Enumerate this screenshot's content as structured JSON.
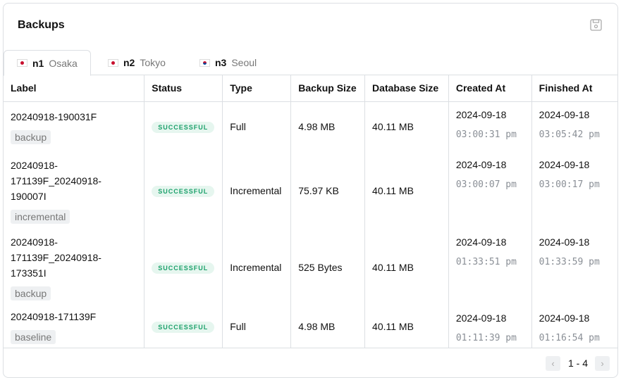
{
  "title": "Backups",
  "tabs": [
    {
      "node": "n1",
      "city": "Osaka",
      "flag": "jp"
    },
    {
      "node": "n2",
      "city": "Tokyo",
      "flag": "jp"
    },
    {
      "node": "n3",
      "city": "Seoul",
      "flag": "kr"
    }
  ],
  "columns": [
    "Label",
    "Status",
    "Type",
    "Backup Size",
    "Database Size",
    "Created At",
    "Finished At"
  ],
  "rows": [
    {
      "label": "20240918-190031F",
      "tag": "backup",
      "status": "SUCCESSFUL",
      "type": "Full",
      "backup_size": "4.98 MB",
      "db_size": "40.11 MB",
      "created_date": "2024-09-18",
      "created_time": "03:00:31 pm",
      "finished_date": "2024-09-18",
      "finished_time": "03:05:42 pm"
    },
    {
      "label": "20240918-171139F_20240918-190007I",
      "tag": "incremental",
      "status": "SUCCESSFUL",
      "type": "Incremental",
      "backup_size": "75.97 KB",
      "db_size": "40.11 MB",
      "created_date": "2024-09-18",
      "created_time": "03:00:07 pm",
      "finished_date": "2024-09-18",
      "finished_time": "03:00:17 pm"
    },
    {
      "label": "20240918-171139F_20240918-173351I",
      "tag": "backup",
      "status": "SUCCESSFUL",
      "type": "Incremental",
      "backup_size": "525 Bytes",
      "db_size": "40.11 MB",
      "created_date": "2024-09-18",
      "created_time": "01:33:51 pm",
      "finished_date": "2024-09-18",
      "finished_time": "01:33:59 pm"
    },
    {
      "label": "20240918-171139F",
      "tag": "baseline",
      "status": "SUCCESSFUL",
      "type": "Full",
      "backup_size": "4.98 MB",
      "db_size": "40.11 MB",
      "created_date": "2024-09-18",
      "created_time": "01:11:39 pm",
      "finished_date": "2024-09-18",
      "finished_time": "01:16:54 pm"
    }
  ],
  "pagination": {
    "range": "1 - 4"
  }
}
